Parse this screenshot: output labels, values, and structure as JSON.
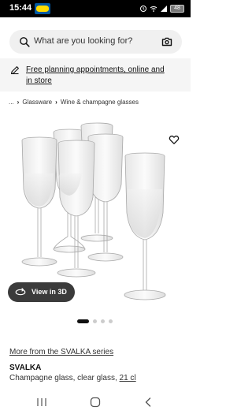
{
  "status_bar": {
    "time": "15:44",
    "battery": "48"
  },
  "search": {
    "placeholder": "What are you looking for?"
  },
  "banner": {
    "text": "Free planning appointments, online and in store"
  },
  "breadcrumb": {
    "root": "...",
    "items": [
      "Glassware",
      "Wine & champagne glasses"
    ]
  },
  "gallery": {
    "view3d_label": "View in 3D",
    "dot_count": 4,
    "active_dot": 0
  },
  "product": {
    "series_link": "More from the SVALKA series",
    "name": "SVALKA",
    "desc_prefix": "Champagne glass, clear glass, ",
    "desc_size": "21 cl"
  },
  "colors": {
    "accent_blue": "#0058a3",
    "accent_yellow": "#ffdb00",
    "pill_bg": "#3b3b3b"
  }
}
